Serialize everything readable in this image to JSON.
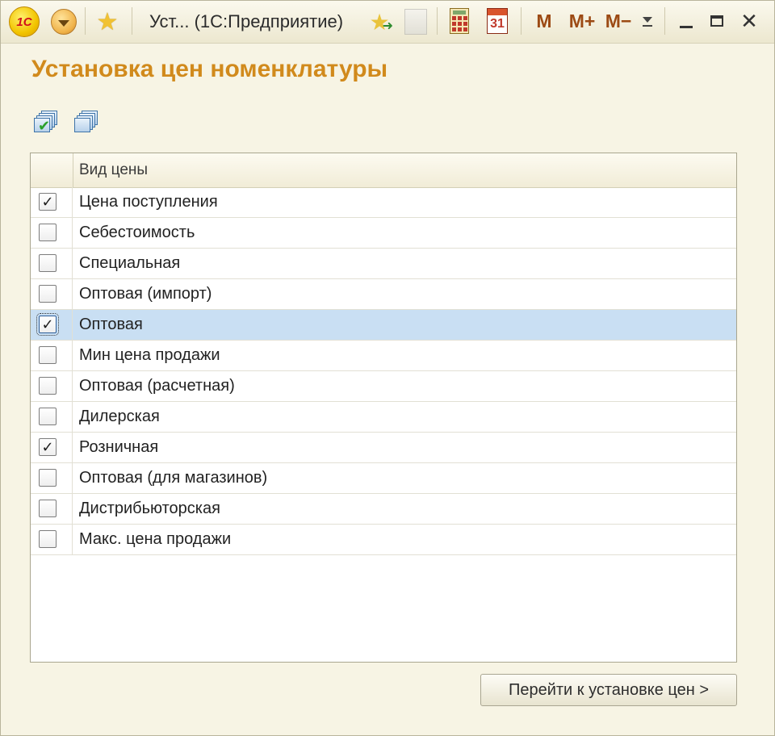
{
  "window": {
    "title": "Уст...  (1С:Предприятие)",
    "logo_text": "1С",
    "memory_buttons": [
      "M",
      "M+",
      "M−"
    ],
    "close_symbol": "✕"
  },
  "form": {
    "title": "Установка цен номенклатуры",
    "commands": [
      "check-all-icon",
      "uncheck-all-icon"
    ]
  },
  "table": {
    "column_header": "Вид цены",
    "rows": [
      {
        "name": "Цена поступления",
        "checked": true
      },
      {
        "name": "Себестоимость",
        "checked": false
      },
      {
        "name": "Специальная",
        "checked": false
      },
      {
        "name": "Оптовая (импорт)",
        "checked": false
      },
      {
        "name": "Оптовая",
        "checked": true,
        "selected": true
      },
      {
        "name": "Мин цена продажи",
        "checked": false
      },
      {
        "name": "Оптовая (расчетная)",
        "checked": false
      },
      {
        "name": "Дилерская",
        "checked": false
      },
      {
        "name": "Розничная",
        "checked": true
      },
      {
        "name": "Оптовая (для магазинов)",
        "checked": false
      },
      {
        "name": "Дистрибьюторская",
        "checked": false
      },
      {
        "name": "Макс. цена продажи",
        "checked": false
      }
    ]
  },
  "footer": {
    "next_button_label": "Перейти к установке цен >"
  },
  "colors": {
    "title": "#d18a1c",
    "selected_row": "#c9dff3",
    "background": "#f7f4e4"
  }
}
